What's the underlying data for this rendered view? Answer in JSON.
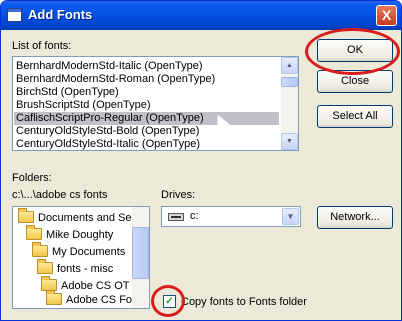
{
  "window": {
    "title": "Add Fonts",
    "close_glyph": "X"
  },
  "list": {
    "label": "List of fonts:",
    "items": [
      "BernhardModernStd-Italic (OpenType)",
      "BernhardModernStd-Roman (OpenType)",
      "BirchStd (OpenType)",
      "BrushScriptStd (OpenType)",
      "CaflischScriptPro-Regular (OpenType)",
      "CenturyOldStyleStd-Bold (OpenType)",
      "CenturyOldStyleStd-Italic (OpenType)"
    ],
    "selected_index": 4
  },
  "buttons": {
    "ok": "OK",
    "close": "Close",
    "select_all": "Select All",
    "network": "Network..."
  },
  "folders": {
    "label": "Folders:",
    "path": "c:\\...\\adobe cs fonts",
    "items": [
      "Documents and Se",
      "Mike Doughty",
      "My Documents",
      "fonts - misc",
      "Adobe CS OT F",
      "Adobe CS Fon"
    ]
  },
  "drives": {
    "label": "Drives:",
    "value": "c:"
  },
  "copy_option": {
    "label": "Copy fonts to Fonts folder",
    "checked": true
  },
  "icons": [
    "window-icon",
    "close-icon",
    "scroll-up-icon",
    "scroll-down-icon",
    "folder-icon",
    "drive-icon",
    "dropdown-arrow-icon",
    "checkmark-icon",
    "mouse-cursor-icon"
  ],
  "colors": {
    "title_bar": "#0650e0",
    "dialog_bg": "#ece9d8",
    "highlight_ring": "#d81c1c",
    "selection": "#c0c0c8"
  }
}
